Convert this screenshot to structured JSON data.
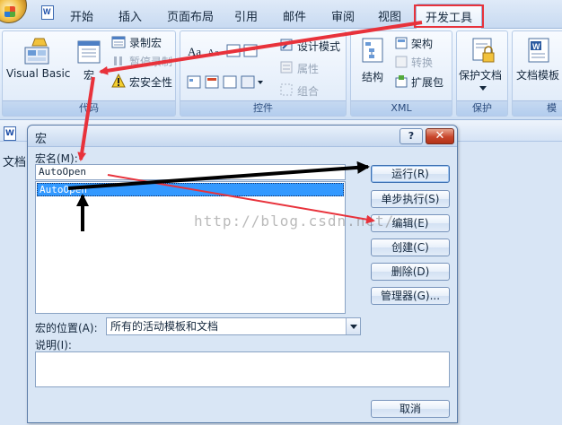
{
  "ribbon": {
    "tabs": [
      {
        "label": "开始"
      },
      {
        "label": "插入"
      },
      {
        "label": "页面布局"
      },
      {
        "label": "引用"
      },
      {
        "label": "邮件"
      },
      {
        "label": "审阅"
      },
      {
        "label": "视图"
      },
      {
        "label": "开发工具",
        "active": true
      }
    ],
    "groups": {
      "code": {
        "label": "代码",
        "visual_basic": "Visual Basic",
        "macros": "宏",
        "record_macro": "录制宏",
        "pause_recording": "暂停录制",
        "macro_security": "宏安全性"
      },
      "controls": {
        "label": "控件",
        "design_mode": "设计模式",
        "properties": "属性",
        "group": "组合"
      },
      "xml": {
        "label": "XML",
        "structure": "结构",
        "schema": "架构",
        "transform": "转换",
        "expansion_packs": "扩展包"
      },
      "protect": {
        "label": "保护",
        "protect_document": "保护文档"
      },
      "templates": {
        "label": "模",
        "document_template": "文档模板"
      }
    }
  },
  "document": {
    "label": "文档"
  },
  "dialog": {
    "title": "宏",
    "help": "?",
    "close": "✕",
    "macro_name_label": "宏名(M):",
    "macro_name_value": "AutoOpen",
    "macros": [
      "AutoOpen"
    ],
    "buttons": {
      "run": "运行(R)",
      "step_into": "单步执行(S)",
      "edit": "编辑(E)",
      "create": "创建(C)",
      "delete": "删除(D)",
      "organizer": "管理器(G)...",
      "cancel": "取消"
    },
    "location_label": "宏的位置(A):",
    "location_value": "所有的活动模板和文档",
    "description_label": "说明(I):"
  },
  "watermark": "http://blog.csdn.net/",
  "colors": {
    "highlight_box": "#e8323b",
    "arrow_red": "#e8323b",
    "arrow_black": "#000000",
    "selection": "#3399ff"
  }
}
